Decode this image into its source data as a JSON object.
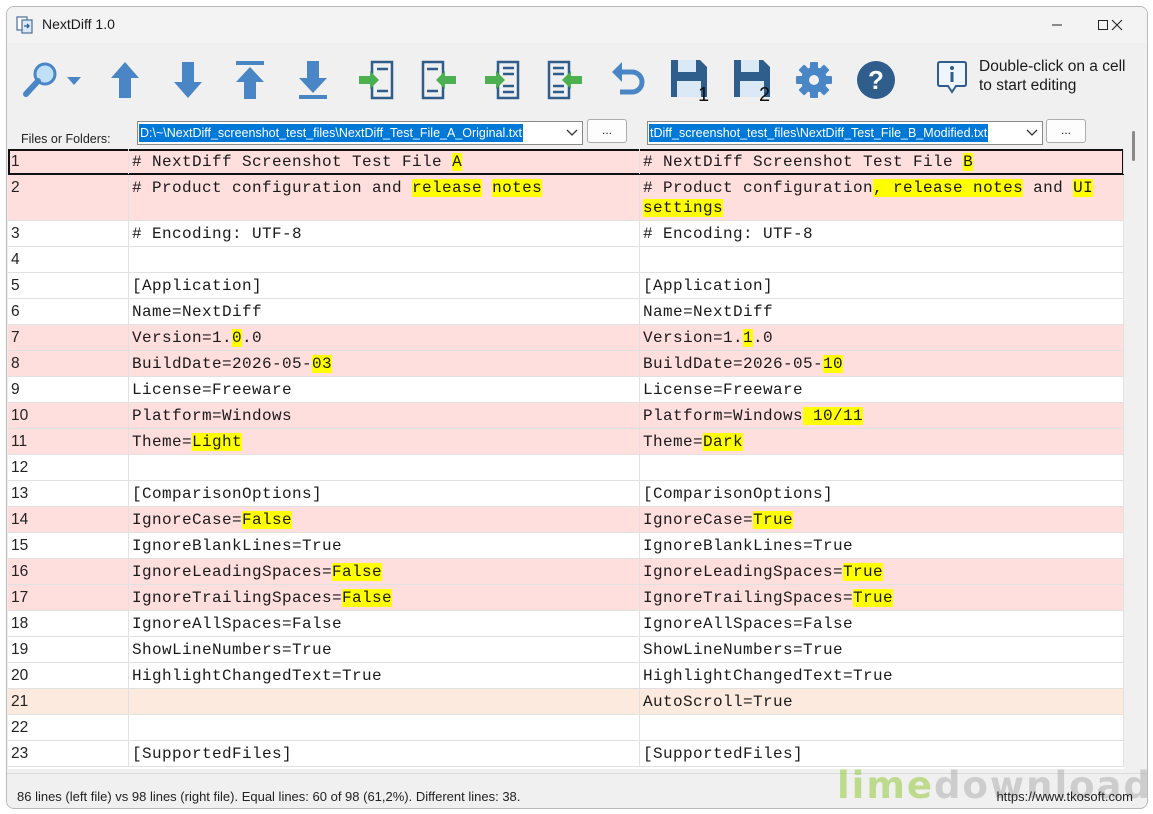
{
  "window": {
    "title": "NextDiff 1.0",
    "minimize_glyph": "—",
    "maximize_glyph": "☐",
    "close_glyph": "✕"
  },
  "toolbar": {
    "buttons": [
      {
        "icon": "search-icon"
      },
      {
        "icon": "dropdown-arrow-icon"
      },
      {
        "icon": "arrow-up-icon"
      },
      {
        "icon": "arrow-down-icon"
      },
      {
        "icon": "arrow-to-top-icon"
      },
      {
        "icon": "arrow-to-bottom-icon"
      },
      {
        "icon": "copy-to-right-icon"
      },
      {
        "icon": "copy-to-left-icon"
      },
      {
        "icon": "copy-all-to-right-icon"
      },
      {
        "icon": "copy-all-to-left-icon"
      },
      {
        "icon": "undo-icon"
      },
      {
        "icon": "save-left-icon",
        "badge": "1"
      },
      {
        "icon": "save-right-icon",
        "badge": "2"
      },
      {
        "icon": "settings-gear-icon"
      },
      {
        "icon": "help-icon",
        "glyph": "?"
      }
    ],
    "hint": "Double-click on a cell to start editing",
    "colors": {
      "blue": "#4a86c5",
      "green": "#4caf50",
      "navy": "#2f5d8c"
    }
  },
  "files": {
    "label": "Files or Folders:",
    "left_path": "D:\\~\\NextDiff_screenshot_test_files\\NextDiff_Test_File_A_Original.txt",
    "right_path": "tDiff_screenshot_test_files\\NextDiff_Test_File_B_Modified.txt",
    "browse_label": "..."
  },
  "rows": [
    {
      "n": "1",
      "type": "diff",
      "left": [
        [
          "# NextDiff Screenshot Test File ",
          false
        ],
        [
          "A",
          true
        ]
      ],
      "right": [
        [
          "# NextDiff Screenshot Test File ",
          false
        ],
        [
          "B",
          true
        ]
      ]
    },
    {
      "n": "2",
      "type": "diff",
      "left": [
        [
          "# Product configuration and ",
          false
        ],
        [
          "release",
          true
        ],
        [
          " ",
          false
        ],
        [
          "notes",
          true
        ]
      ],
      "right": [
        [
          "# Product configuration",
          false
        ],
        [
          ", release notes",
          true
        ],
        [
          " and ",
          false
        ],
        [
          "UI",
          true
        ],
        [
          " ",
          false
        ],
        [
          "settings",
          true
        ]
      ]
    },
    {
      "n": "3",
      "type": "same",
      "left": [
        [
          "# Encoding: UTF-8",
          false
        ]
      ],
      "right": [
        [
          "# Encoding: UTF-8",
          false
        ]
      ]
    },
    {
      "n": "4",
      "type": "same",
      "left": [],
      "right": []
    },
    {
      "n": "5",
      "type": "same",
      "left": [
        [
          "[Application]",
          false
        ]
      ],
      "right": [
        [
          "[Application]",
          false
        ]
      ]
    },
    {
      "n": "6",
      "type": "same",
      "left": [
        [
          "Name=NextDiff",
          false
        ]
      ],
      "right": [
        [
          "Name=NextDiff",
          false
        ]
      ]
    },
    {
      "n": "7",
      "type": "diff",
      "left": [
        [
          "Version=1.",
          false
        ],
        [
          "0",
          true
        ],
        [
          ".0",
          false
        ]
      ],
      "right": [
        [
          "Version=1.",
          false
        ],
        [
          "1",
          true
        ],
        [
          ".0",
          false
        ]
      ]
    },
    {
      "n": "8",
      "type": "diff",
      "left": [
        [
          "BuildDate=2026-05-",
          false
        ],
        [
          "03",
          true
        ]
      ],
      "right": [
        [
          "BuildDate=2026-05-",
          false
        ],
        [
          "10",
          true
        ]
      ]
    },
    {
      "n": "9",
      "type": "same",
      "left": [
        [
          "License=Freeware",
          false
        ]
      ],
      "right": [
        [
          "License=Freeware",
          false
        ]
      ]
    },
    {
      "n": "10",
      "type": "diff",
      "left": [
        [
          "Platform=Windows",
          false
        ]
      ],
      "right": [
        [
          "Platform=Windows",
          false
        ],
        [
          " 10/11",
          true
        ]
      ]
    },
    {
      "n": "11",
      "type": "diff",
      "left": [
        [
          "Theme=",
          false
        ],
        [
          "Light",
          true
        ]
      ],
      "right": [
        [
          "Theme=",
          false
        ],
        [
          "Dark",
          true
        ]
      ]
    },
    {
      "n": "12",
      "type": "same",
      "left": [],
      "right": []
    },
    {
      "n": "13",
      "type": "same",
      "left": [
        [
          "[ComparisonOptions]",
          false
        ]
      ],
      "right": [
        [
          "[ComparisonOptions]",
          false
        ]
      ]
    },
    {
      "n": "14",
      "type": "diff",
      "left": [
        [
          "IgnoreCase=",
          false
        ],
        [
          "False",
          true
        ]
      ],
      "right": [
        [
          "IgnoreCase=",
          false
        ],
        [
          "True",
          true
        ]
      ]
    },
    {
      "n": "15",
      "type": "same",
      "left": [
        [
          "IgnoreBlankLines=True",
          false
        ]
      ],
      "right": [
        [
          "IgnoreBlankLines=True",
          false
        ]
      ]
    },
    {
      "n": "16",
      "type": "diff",
      "left": [
        [
          "IgnoreLeadingSpaces=",
          false
        ],
        [
          "False",
          true
        ]
      ],
      "right": [
        [
          "IgnoreLeadingSpaces=",
          false
        ],
        [
          "True",
          true
        ]
      ]
    },
    {
      "n": "17",
      "type": "diff",
      "left": [
        [
          "IgnoreTrailingSpaces=",
          false
        ],
        [
          "False",
          true
        ]
      ],
      "right": [
        [
          "IgnoreTrailingSpaces=",
          false
        ],
        [
          "True",
          true
        ]
      ]
    },
    {
      "n": "18",
      "type": "same",
      "left": [
        [
          "IgnoreAllSpaces=False",
          false
        ]
      ],
      "right": [
        [
          "IgnoreAllSpaces=False",
          false
        ]
      ]
    },
    {
      "n": "19",
      "type": "same",
      "left": [
        [
          "ShowLineNumbers=True",
          false
        ]
      ],
      "right": [
        [
          "ShowLineNumbers=True",
          false
        ]
      ]
    },
    {
      "n": "20",
      "type": "same",
      "left": [
        [
          "HighlightChangedText=True",
          false
        ]
      ],
      "right": [
        [
          "HighlightChangedText=True",
          false
        ]
      ]
    },
    {
      "n": "21",
      "type": "added",
      "left": [],
      "right": [
        [
          "AutoScroll=True",
          false
        ]
      ]
    },
    {
      "n": "22",
      "type": "same",
      "left": [],
      "right": []
    },
    {
      "n": "23",
      "type": "same",
      "left": [
        [
          "[SupportedFiles]",
          false
        ]
      ],
      "right": [
        [
          "[SupportedFiles]",
          false
        ]
      ]
    }
  ],
  "status": {
    "summary": "86 lines (left file) vs 98 lines (right file). Equal lines: 60 of 98 (61,2%). Different lines: 38.",
    "url": "https://www.tkosoft.com",
    "watermark_a": "lime",
    "watermark_b": "download.com"
  },
  "colors": {
    "diff_row": "#ffdede",
    "added_row": "#fdeade",
    "highlight": "#ffff00",
    "selection": "#0078d7"
  }
}
